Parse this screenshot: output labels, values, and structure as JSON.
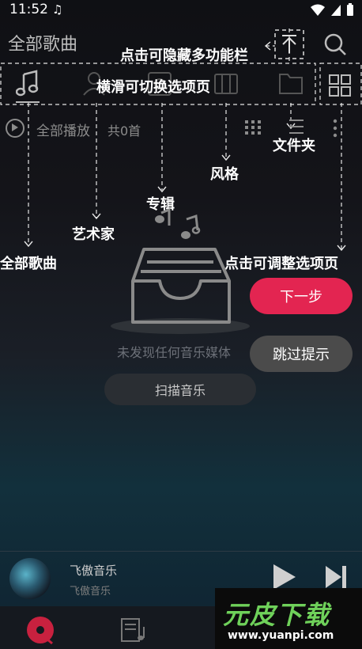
{
  "status_bar": {
    "time": "11:52"
  },
  "header": {
    "title": "全部歌曲"
  },
  "play_row": {
    "play_all": "全部播放",
    "count": "共0首"
  },
  "annotations": {
    "hide_toolbar": "点击可隐藏多功能栏",
    "swipe_tabs": "横滑可切换选项页",
    "folder": "文件夹",
    "genre": "风格",
    "album": "专辑",
    "artist": "艺术家",
    "all_songs": "全部歌曲",
    "adjust_tabs": "点击可调整选项页"
  },
  "empty_state": {
    "message": "未发现任何音乐媒体",
    "scan_button": "扫描音乐"
  },
  "guide": {
    "next": "下一步",
    "skip": "跳过提示"
  },
  "player": {
    "title": "飞傲音乐",
    "artist": "飞傲音乐"
  },
  "watermark": {
    "brand": "元皮下载",
    "url": "www.yuanpi.com"
  },
  "colors": {
    "accent": "#e32551",
    "watermark_green": "#6fd15a"
  }
}
